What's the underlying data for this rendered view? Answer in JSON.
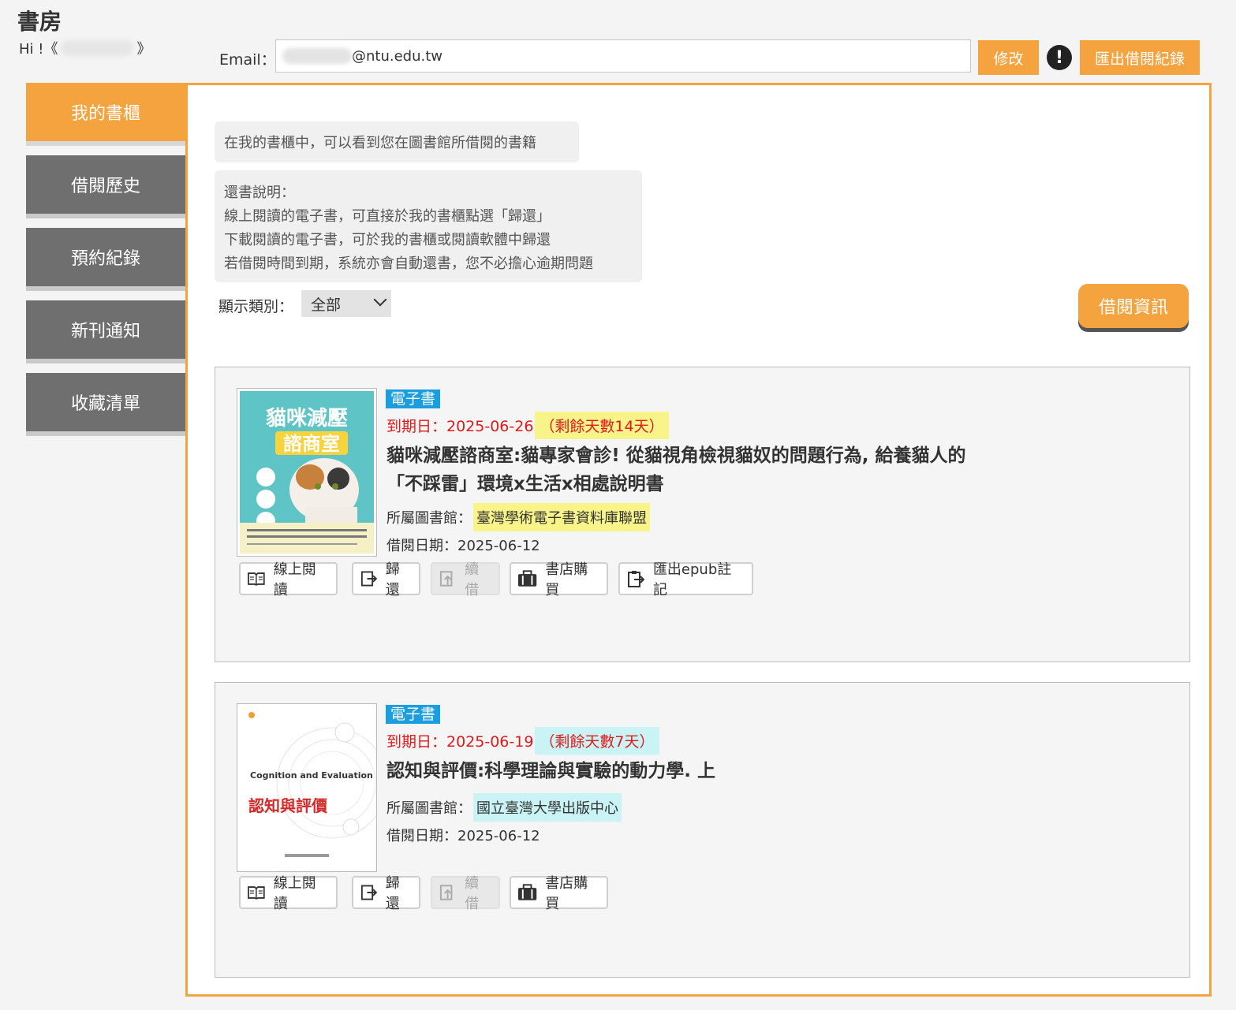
{
  "header": {
    "title": "書房",
    "greeting_prefix": "Hi !《",
    "greeting_suffix": "》",
    "email_label": "Email：",
    "email_domain": "@ntu.edu.tw",
    "modify_button": "修改",
    "warning_icon": "!",
    "export_button": "匯出借閱紀錄"
  },
  "sidebar": {
    "items": [
      {
        "label": "我的書櫃",
        "active": true
      },
      {
        "label": "借閱歷史"
      },
      {
        "label": "預約紀錄"
      },
      {
        "label": "新刊通知"
      },
      {
        "label": "收藏清單"
      }
    ]
  },
  "main": {
    "intro": "在我的書櫃中，可以看到您在圖書館所借閱的書籍",
    "return_notes": [
      "還書說明：",
      "線上閱讀的電子書，可直接於我的書櫃點選「歸還」",
      "下載閱讀的電子書，可於我的書櫃或閱讀軟體中歸還",
      "若借閱時間到期，系統亦會自動還書，您不必擔心逾期問題"
    ],
    "filter_label": "顯示類別：",
    "filter_value": "全部",
    "borrow_info_button": "借閱資訊"
  },
  "books": [
    {
      "tag": "電子書",
      "due": "到期日：2025-06-26",
      "remaining": "（剩餘天數14天）",
      "title_line1": "貓咪減壓諮商室:貓專家會診! 從貓視角檢視貓奴的問題行為, 給養貓人的",
      "title_line2": "「不踩雷」環境x生活x相處說明書",
      "library_label": "所屬圖書館：",
      "library_name": "臺灣學術電子書資料庫聯盟",
      "borrow_date": "借閱日期：2025-06-12",
      "cover_title_1": "貓咪減壓",
      "cover_title_2": "諮商室",
      "actions": {
        "read": "線上閱讀",
        "return": "歸還",
        "renew": "續借",
        "buy": "書店購買",
        "export": "匯出epub註記"
      },
      "highlight_color": "#f8f48a"
    },
    {
      "tag": "電子書",
      "due": "到期日：2025-06-19",
      "remaining": "（剩餘天數7天）",
      "title_line1": "認知與評價:科學理論與實驗的動力學. 上",
      "library_label": "所屬圖書館：",
      "library_name": "國立臺灣大學出版中心",
      "borrow_date": "借閱日期：2025-06-12",
      "cover_title_en": "Cognition and Evaluation",
      "cover_title_zh": "認知與評價",
      "actions": {
        "read": "線上閱讀",
        "return": "歸還",
        "renew": "續借",
        "buy": "書店購買"
      },
      "highlight_color": "#c9f3f5"
    }
  ],
  "colors": {
    "accent": "#f5a33f",
    "tag_blue": "#1a9ee0",
    "due_red": "#e0191b"
  }
}
